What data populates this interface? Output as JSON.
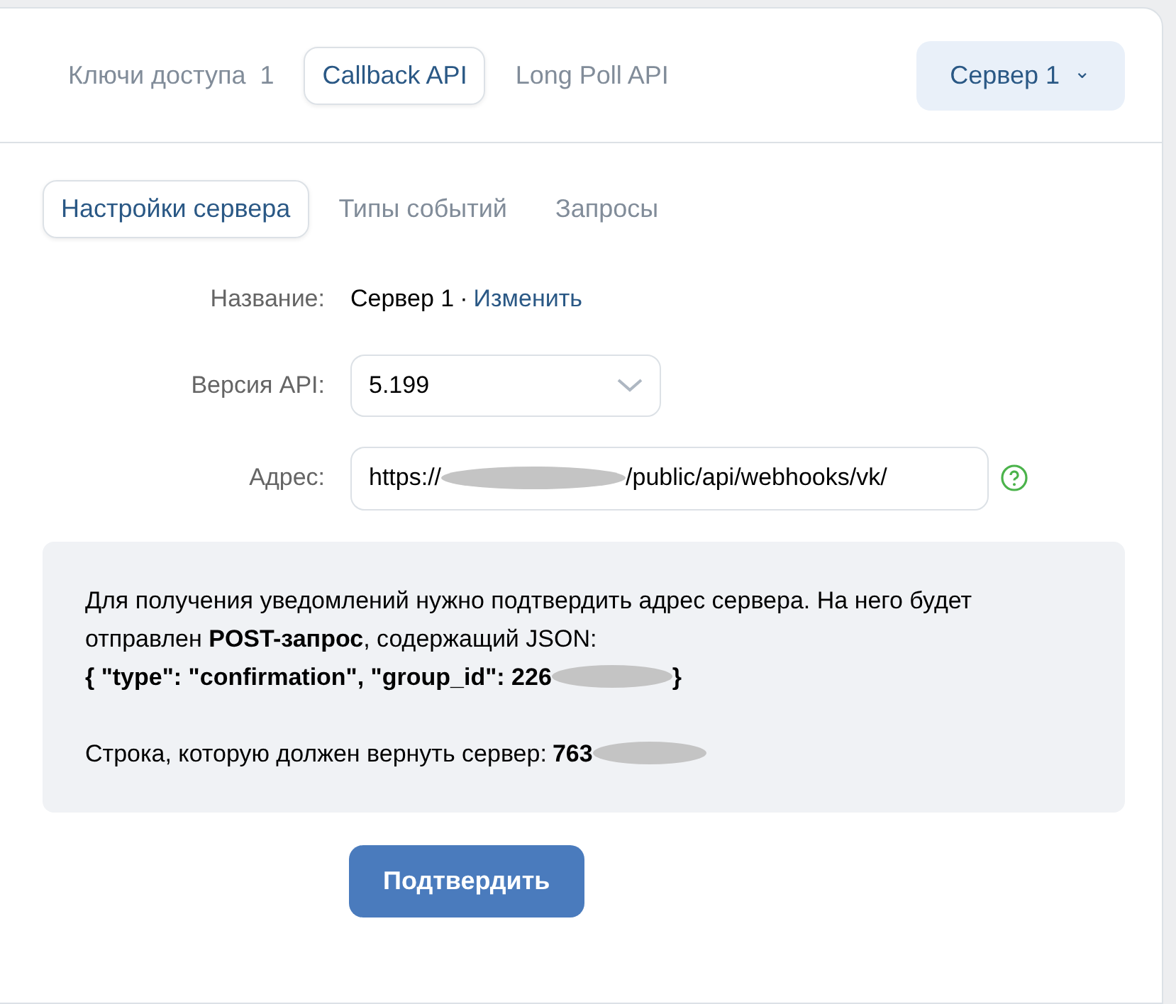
{
  "tabs": [
    {
      "label": "Ключи доступа",
      "count": "1",
      "selected": false
    },
    {
      "label": "Callback API",
      "selected": true
    },
    {
      "label": "Long Poll API",
      "selected": false
    }
  ],
  "server_menu": {
    "label": "Сервер 1",
    "caret": "⌄"
  },
  "subtabs": [
    {
      "label": "Настройки сервера",
      "selected": true
    },
    {
      "label": "Типы событий",
      "selected": false
    },
    {
      "label": "Запросы",
      "selected": false
    }
  ],
  "form": {
    "name": {
      "label": "Название:",
      "value": "Сервер 1",
      "separator": "·",
      "link": "Изменить"
    },
    "api_version": {
      "label": "Версия API:",
      "value": "5.199"
    },
    "address": {
      "label": "Адрес:",
      "value_start": "https://",
      "value_end": "/public/api/webhooks/vk/",
      "redacted": true
    }
  },
  "info": {
    "text": "Для получения уведомлений нужно подтвердить адрес сервера. На него будет отправлен **POST-запрос**, содержащий JSON:",
    "json_start": "{ \"type\": \"confirmation\", \"group_id\": 226",
    "json_end": "}",
    "json_redacted": true,
    "code_label": "Строка, которую должен вернуть сервер:",
    "code_start": "763",
    "code_redacted": true
  },
  "confirm_button": "Подтвердить"
}
